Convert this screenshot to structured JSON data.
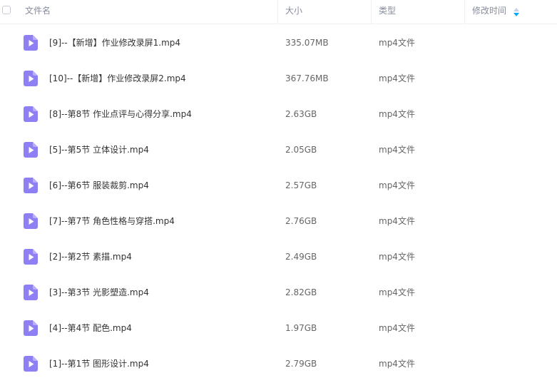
{
  "header": {
    "name_label": "文件名",
    "size_label": "大小",
    "type_label": "类型",
    "modified_label": "修改时间"
  },
  "colors": {
    "icon_accent": "#8f7ff5",
    "sort_arrow": "#06a7ff"
  },
  "files": [
    {
      "name": "[9]--【新增】作业修改录屏1.mp4",
      "size": "335.07MB",
      "type": "mp4文件",
      "icon": "video-file-icon"
    },
    {
      "name": "[10]--【新增】作业修改录屏2.mp4",
      "size": "367.76MB",
      "type": "mp4文件",
      "icon": "video-file-icon"
    },
    {
      "name": "[8]--第8节 作业点评与心得分享.mp4",
      "size": "2.63GB",
      "type": "mp4文件",
      "icon": "video-file-icon"
    },
    {
      "name": "[5]--第5节 立体设计.mp4",
      "size": "2.05GB",
      "type": "mp4文件",
      "icon": "video-file-icon"
    },
    {
      "name": "[6]--第6节 服装裁剪.mp4",
      "size": "2.57GB",
      "type": "mp4文件",
      "icon": "video-file-icon"
    },
    {
      "name": "[7]--第7节 角色性格与穿搭.mp4",
      "size": "2.76GB",
      "type": "mp4文件",
      "icon": "video-file-icon"
    },
    {
      "name": "[2]--第2节 素描.mp4",
      "size": "2.49GB",
      "type": "mp4文件",
      "icon": "video-file-icon"
    },
    {
      "name": "[3]--第3节 光影塑造.mp4",
      "size": "2.82GB",
      "type": "mp4文件",
      "icon": "video-file-icon"
    },
    {
      "name": "[4]--第4节 配色.mp4",
      "size": "1.97GB",
      "type": "mp4文件",
      "icon": "video-file-icon"
    },
    {
      "name": "[1]--第1节 图形设计.mp4",
      "size": "2.79GB",
      "type": "mp4文件",
      "icon": "video-file-icon"
    }
  ]
}
